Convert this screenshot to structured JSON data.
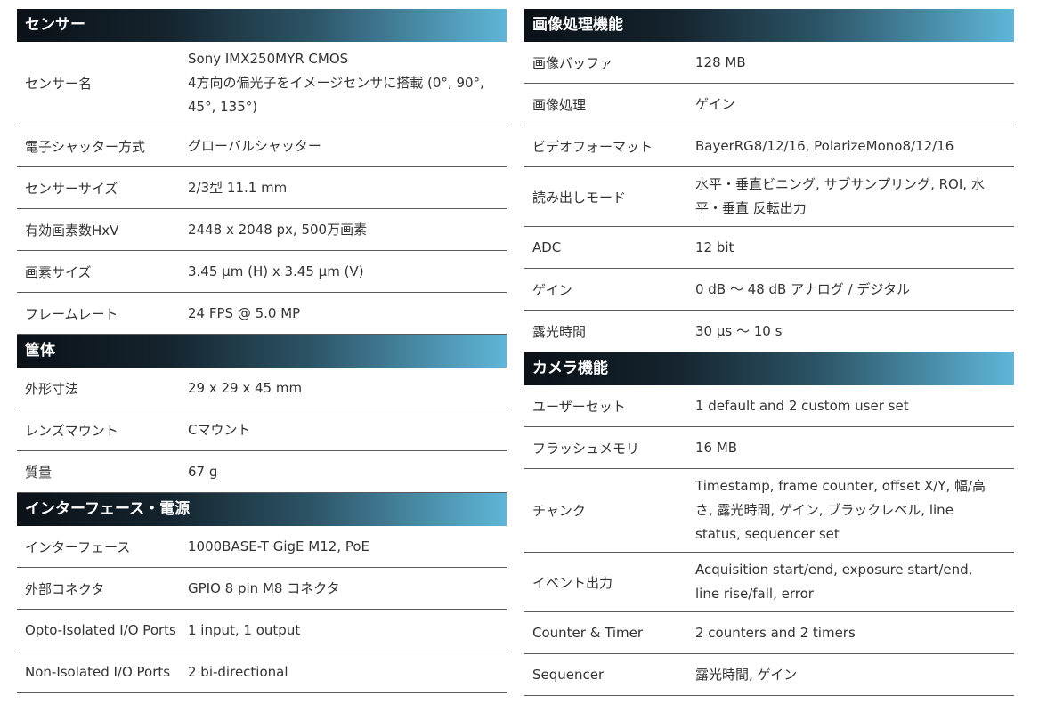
{
  "left_column": [
    {
      "title": "センサー",
      "rows": [
        {
          "label": "センサー名",
          "value": "Sony IMX250MYR CMOS\n4方向の偏光子をイメージセンサに搭載 (0°, 90°,\n45°, 135°)"
        },
        {
          "label": "電子シャッター方式",
          "value": "グローバルシャッター"
        },
        {
          "label": "センサーサイズ",
          "value": "2/3型 11.1 mm"
        },
        {
          "label": "有効画素数HxV",
          "value": "2448 x 2048 px, 500万画素"
        },
        {
          "label": "画素サイズ",
          "value": "3.45 µm (H) x 3.45 µm (V)"
        },
        {
          "label": "フレームレート",
          "value": "24 FPS @ 5.0 MP"
        }
      ]
    },
    {
      "title": "筐体",
      "rows": [
        {
          "label": "外形寸法",
          "value": "29 x 29 x 45 mm"
        },
        {
          "label": "レンズマウント",
          "value": "Cマウント"
        },
        {
          "label": "質量",
          "value": "67 g"
        }
      ]
    },
    {
      "title": "インターフェース・電源",
      "rows": [
        {
          "label": "インターフェース",
          "value": "1000BASE-T GigE M12, PoE"
        },
        {
          "label": "外部コネクタ",
          "value": "GPIO 8 pin M8 コネクタ"
        },
        {
          "label": "Opto-Isolated I/O Ports",
          "value": "1 input, 1 output"
        },
        {
          "label": "Non-Isolated I/O Ports",
          "value": "2 bi-directional"
        }
      ]
    }
  ],
  "right_column": [
    {
      "title": "画像処理機能",
      "rows": [
        {
          "label": "画像バッファ",
          "value": "128 MB"
        },
        {
          "label": "画像処理",
          "value": "ゲイン"
        },
        {
          "label": "ビデオフォーマット",
          "value": "BayerRG8/12/16, PolarizeMono8/12/16"
        },
        {
          "label": "読み出しモード",
          "value": "水平・垂直ビニング, サブサンプリング, ROI, 水\n平・垂直 反転出力"
        },
        {
          "label": "ADC",
          "value": "12 bit"
        },
        {
          "label": "ゲイン",
          "value": "0 dB ～ 48 dB アナログ / デジタル"
        },
        {
          "label": "露光時間",
          "value": "30 µs ～ 10 s"
        }
      ]
    },
    {
      "title": "カメラ機能",
      "rows": [
        {
          "label": "ユーザーセット",
          "value": "1 default and 2 custom user set"
        },
        {
          "label": "フラッシュメモリ",
          "value": "16 MB"
        },
        {
          "label": "チャンク",
          "value": "Timestamp, frame counter, offset X/Y, 幅/高\nさ, 露光時間, ゲイン, ブラックレベル, line\nstatus, sequencer set"
        },
        {
          "label": "イベント出力",
          "value": "Acquisition start/end, exposure start/end,\nline rise/fall, error"
        },
        {
          "label": "Counter & Timer",
          "value": "2 counters and 2 timers"
        },
        {
          "label": "Sequencer",
          "value": "露光時間, ゲイン"
        }
      ]
    }
  ]
}
